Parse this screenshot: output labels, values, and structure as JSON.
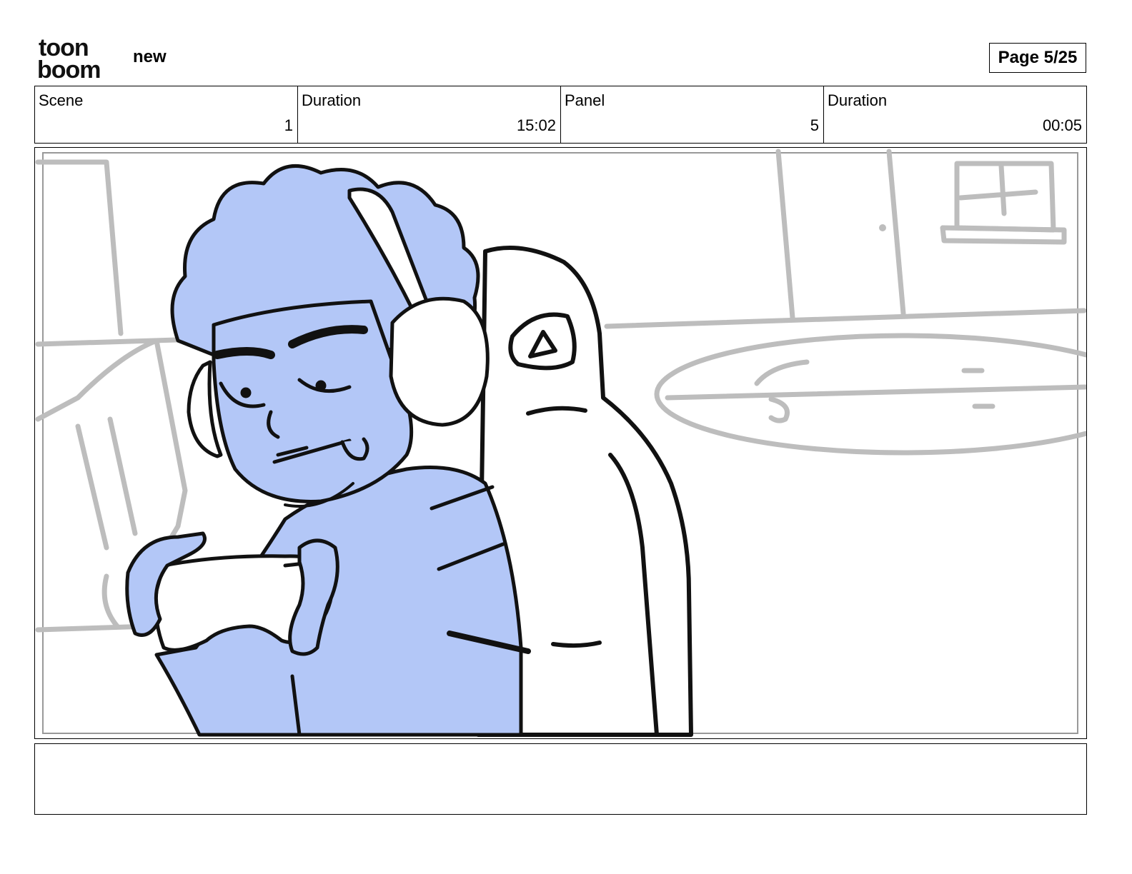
{
  "header": {
    "logo_line1": "toon",
    "logo_line2": "boom",
    "project_name": "new",
    "page_label": "Page",
    "page_number": "5/25"
  },
  "info": {
    "scene_label": "Scene",
    "scene_value": "1",
    "scene_duration_label": "Duration",
    "scene_duration_value": "15:02",
    "panel_label": "Panel",
    "panel_value": "5",
    "panel_duration_label": "Duration",
    "panel_duration_value": "00:05"
  },
  "colors": {
    "character_fill": "#b3c7f7",
    "line": "#111111",
    "background_sketch": "#bdbdbd"
  },
  "notes": ""
}
